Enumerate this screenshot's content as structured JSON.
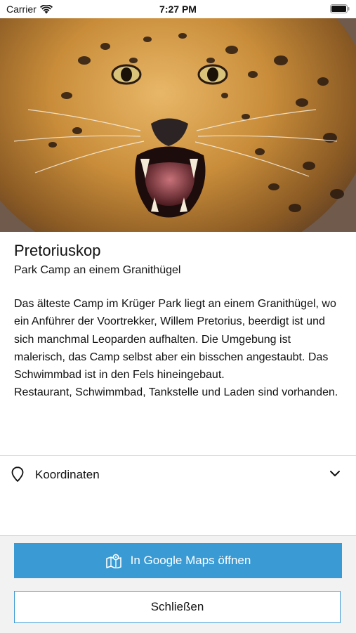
{
  "status_bar": {
    "carrier": "Carrier",
    "time": "7:27 PM"
  },
  "hero": {
    "image_subject": "leopard",
    "pages": 1,
    "current_page": 1
  },
  "camp": {
    "name": "Pretoriuskop",
    "subtitle": "Park Camp an einem Granithügel",
    "description": [
      "Das älteste Camp im Krüger Park liegt an einem Granithügel, wo ein Anführer der Voortrekker, Willem Pretorius, beerdigt ist und sich manchmal Leoparden aufhalten. Die Umgebung ist malerisch, das Camp selbst aber ein bisschen angestaubt. Das Schwimmbad ist in den Fels hineingebaut.",
      "Restaurant, Schwimmbad, Tankstelle und Laden sind vorhanden."
    ]
  },
  "coordinates": {
    "label": "Koordinaten",
    "icon": "map-pin-icon",
    "expand_icon": "chevron-down-icon"
  },
  "actions": {
    "maps_label": "In Google Maps öffnen",
    "maps_icon": "map-icon",
    "close_label": "Schließen"
  },
  "colors": {
    "accent": "#3a9ad4",
    "panel_bg": "#f2f2f2"
  }
}
